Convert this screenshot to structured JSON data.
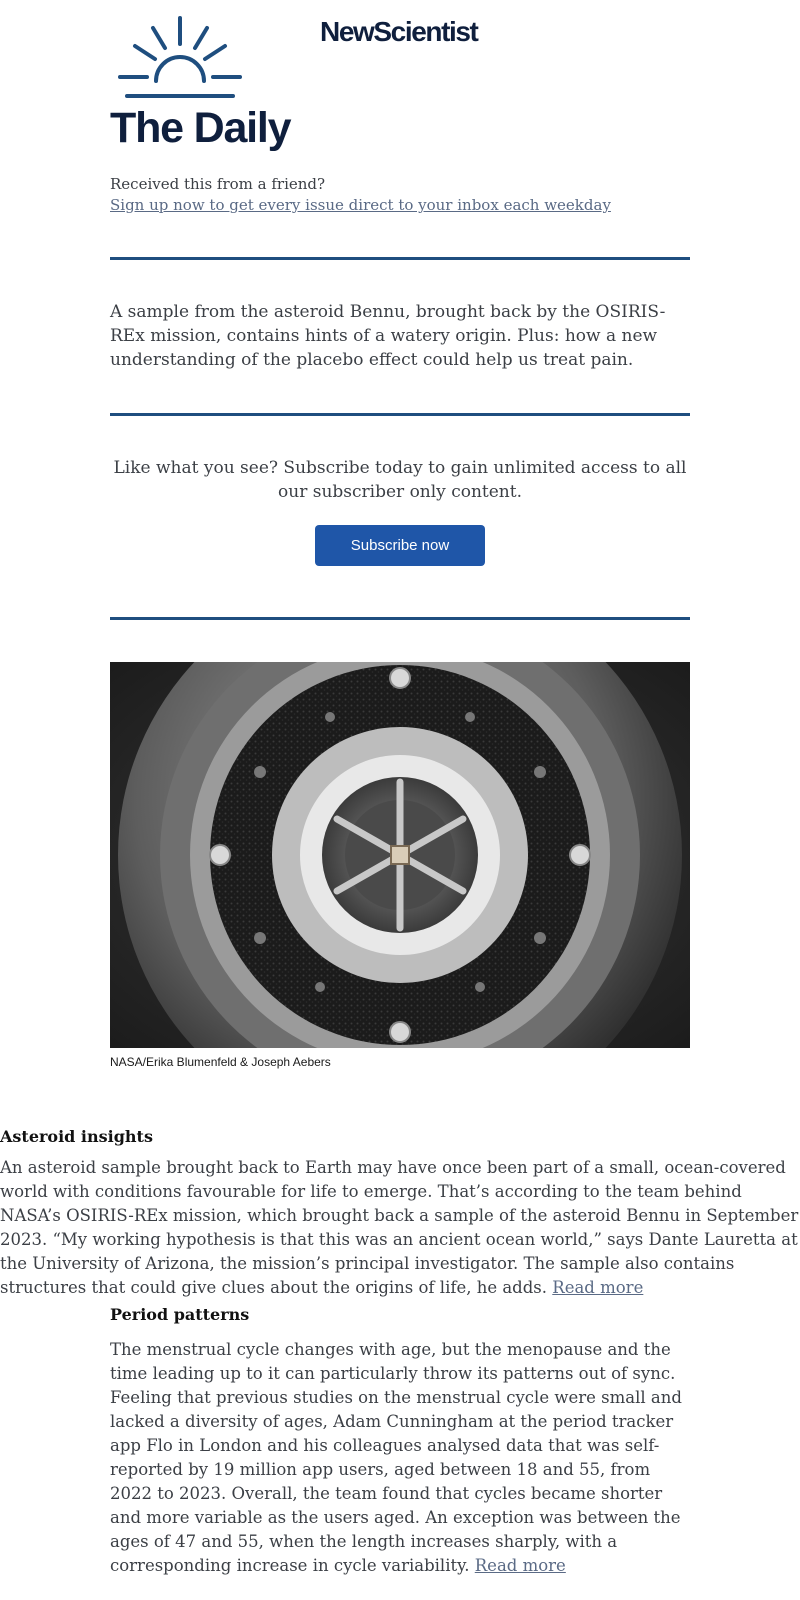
{
  "header": {
    "brand": "NewScientist",
    "title": "The Daily"
  },
  "referral": {
    "question": "Received this from a friend?",
    "signup_link": "Sign up now to get every issue direct to your inbox each weekday"
  },
  "intro": "A sample from the asteroid Bennu, brought back by the OSIRIS-REx mission, contains hints of a watery origin. Plus: how a new understanding of the placebo effect could help us treat pain.",
  "promo": {
    "text": "Like what you see? Subscribe today to gain unlimited access to all our subscriber only content.",
    "button_label": "Subscribe now"
  },
  "image": {
    "caption": "NASA/Erika Blumenfeld & Joseph Aebers"
  },
  "articles": [
    {
      "heading": "Asteroid insights",
      "body": "An asteroid sample brought back to Earth may have once been part of a small, ocean-covered world with conditions favourable for life to emerge. That’s according to the team behind NASA’s OSIRIS-REx mission, which brought back a sample of the asteroid Bennu in September 2023. “My working hypothesis is that this was an ancient ocean world,” says Dante Lauretta at the University of Arizona, the mission’s principal investigator. The sample also contains structures that could give clues about the origins of life, he adds.",
      "link_label": "Read more"
    },
    {
      "heading": "Period patterns",
      "body": "The menstrual cycle changes with age, but the menopause and the time leading up to it can particularly throw its patterns out of sync. Feeling that previous studies on the menstrual cycle were small and lacked a diversity of ages, Adam Cunningham at the period tracker app Flo in London and his colleagues analysed data that was self-reported by 19 million app users, aged between 18 and 55, from 2022 to 2023. Overall, the team found that cycles became shorter and more variable as the users aged. An exception was between the ages of 47 and 55, when the length increases sharply, with a corresponding increase in cycle variability.",
      "link_label": "Read more"
    }
  ],
  "colors": {
    "navy": "#0f1f3d",
    "logo_blue": "#1f4e7f",
    "button_blue": "#1f56a8",
    "link": "#5a6a85",
    "body_text": "#3b3f45"
  }
}
